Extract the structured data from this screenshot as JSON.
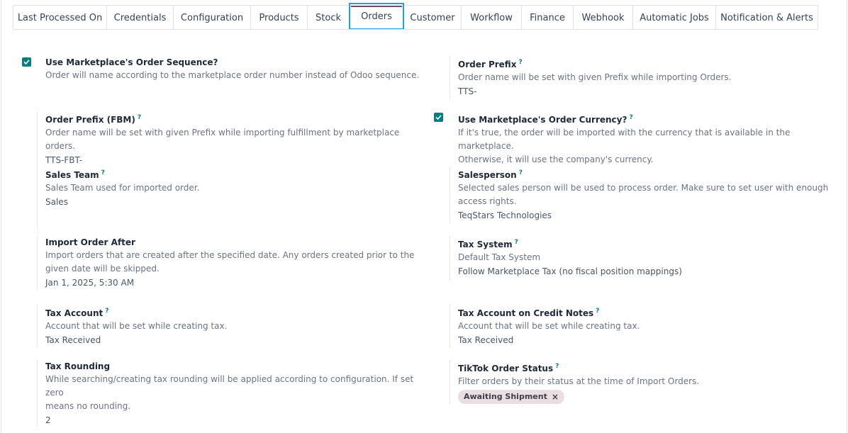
{
  "tabs": [
    {
      "label": "Last Processed On"
    },
    {
      "label": "Credentials"
    },
    {
      "label": "Configuration"
    },
    {
      "label": "Products"
    },
    {
      "label": "Stock"
    },
    {
      "label": "Orders",
      "active": true
    },
    {
      "label": "Customer"
    },
    {
      "label": "Workflow"
    },
    {
      "label": "Finance"
    },
    {
      "label": "Webhook"
    },
    {
      "label": "Automatic Jobs"
    },
    {
      "label": "Notification & Alerts"
    }
  ],
  "settings": {
    "marketplace_sequence": {
      "label": "Use Marketplace's Order Sequence?",
      "desc": "Order will name according to the marketplace order number instead of Odoo sequence.",
      "checked": true
    },
    "order_prefix": {
      "label": "Order Prefix",
      "desc": "Order name will be set with given Prefix while importing Orders.",
      "value": "TTS-"
    },
    "order_prefix_fbm": {
      "label": "Order Prefix (FBM)",
      "desc": "Order name will be set with given Prefix while importing fulfillment by marketplace orders.",
      "value": "TTS-FBT-"
    },
    "marketplace_currency": {
      "label": "Use Marketplace's Order Currency?",
      "desc1": "If it's true, the order will be imported with the currency that is available in the marketplace.",
      "desc2": "Otherwise, it will use the company's currency.",
      "checked": true
    },
    "sales_team": {
      "label": "Sales Team",
      "desc": "Sales Team used for imported order.",
      "value": "Sales"
    },
    "salesperson": {
      "label": "Salesperson",
      "desc1": "Selected sales person will be used to process order. Make sure to set user with enough",
      "desc2": "access rights.",
      "value": "TeqStars Technologies"
    },
    "import_after": {
      "label": "Import Order After",
      "desc1": "Import orders that are created after the specified date. Any orders created prior to the",
      "desc2": "given date will be skipped.",
      "value": "Jan 1, 2025, 5:30 AM"
    },
    "tax_system": {
      "label": "Tax System",
      "desc": "Default Tax System",
      "value": "Follow Marketplace Tax (no fiscal position mappings)"
    },
    "tax_account": {
      "label": "Tax Account",
      "desc": "Account that will be set while creating tax.",
      "value": "Tax Received"
    },
    "tax_account_credit": {
      "label": "Tax Account on Credit Notes",
      "desc": "Account that will be set while creating tax.",
      "value": "Tax Received"
    },
    "tax_rounding": {
      "label": "Tax Rounding",
      "desc1": "While searching/creating tax rounding will be applied according to configuration. If set zero",
      "desc2": "means no rounding.",
      "value": "2"
    },
    "tiktok_status": {
      "label": "TikTok Order Status",
      "desc": "Filter orders by their status at the time of Import Orders.",
      "tag": "Awaiting Shipment"
    }
  },
  "help_mark": "?",
  "remove_glyph": "×",
  "colors": {
    "accent": "#017e84",
    "active_tab_border": "#1aa3e8",
    "tab_top": "#714b67",
    "tag_bg": "#e9dfe2"
  }
}
